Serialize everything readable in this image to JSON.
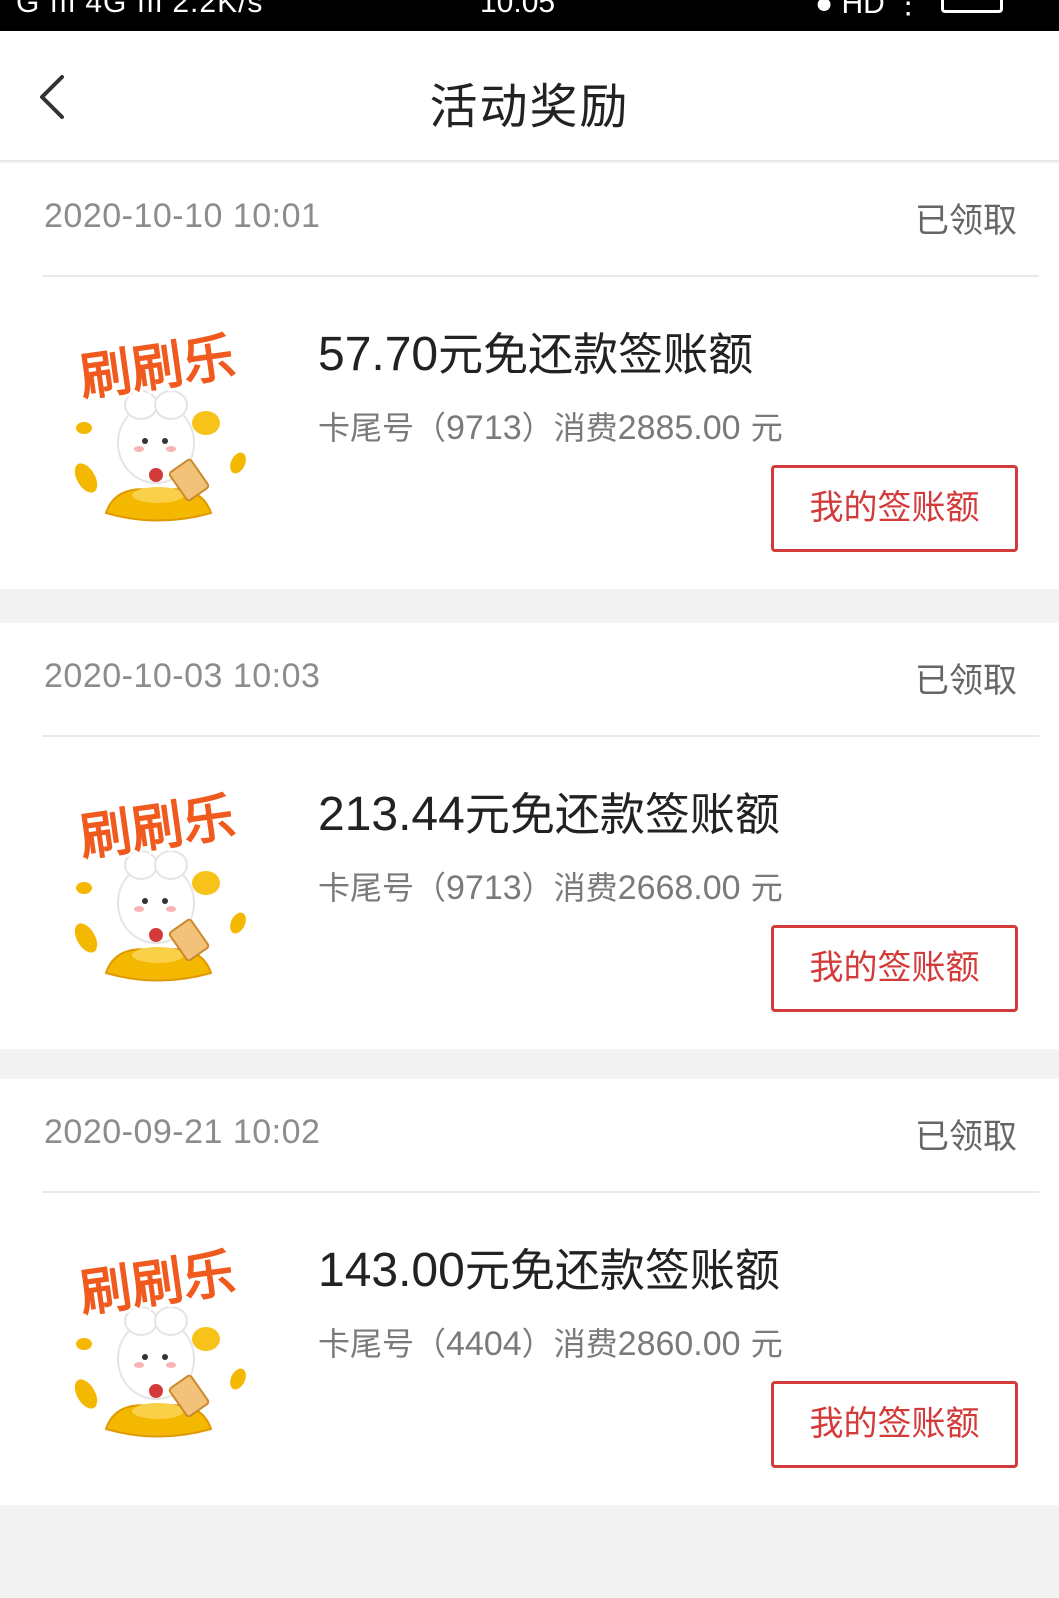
{
  "status_bar": {
    "left": "G ııl 4G ııl 2.2K/s",
    "time": "10:05",
    "right": "● HD"
  },
  "header": {
    "title": "活动奖励",
    "back_icon": "chevron-left-icon"
  },
  "rewards": [
    {
      "date": "2020-10-10 10:01",
      "status": "已领取",
      "amount": "57.70",
      "title_suffix": "元免还款签账额",
      "desc_prefix": "卡尾号（",
      "card_tail": "9713",
      "desc_mid": "）消费",
      "spend": "2885.00",
      "desc_suffix": " 元",
      "button": "我的签账额",
      "image_text": "刷刷乐"
    },
    {
      "date": "2020-10-03 10:03",
      "status": "已领取",
      "amount": "213.44",
      "title_suffix": "元免还款签账额",
      "desc_prefix": "卡尾号（",
      "card_tail": "9713",
      "desc_mid": "）消费",
      "spend": "2668.00",
      "desc_suffix": " 元",
      "button": "我的签账额",
      "image_text": "刷刷乐"
    },
    {
      "date": "2020-09-21 10:02",
      "status": "已领取",
      "amount": "143.00",
      "title_suffix": "元免还款签账额",
      "desc_prefix": "卡尾号（",
      "card_tail": "4404",
      "desc_mid": "）消费",
      "spend": "2860.00",
      "desc_suffix": " 元",
      "button": "我的签账额",
      "image_text": "刷刷乐"
    }
  ],
  "colors": {
    "accent_red": "#d33a3a",
    "logo_orange": "#f05a1e",
    "coin_gold": "#f5b800",
    "page_bg": "#f2f2f2"
  }
}
